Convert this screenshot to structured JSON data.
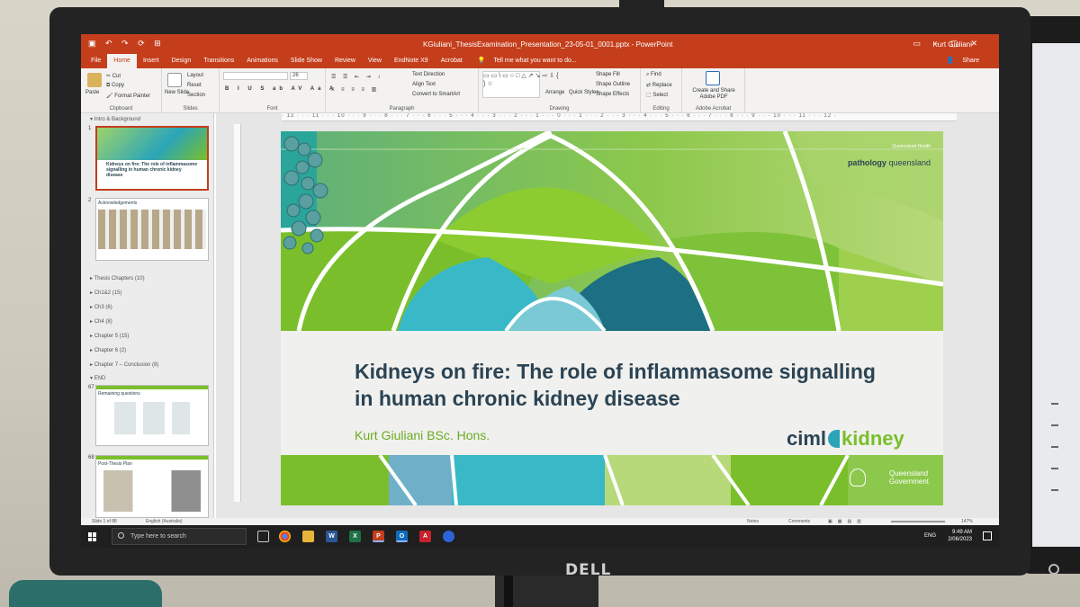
{
  "window": {
    "title": "KGiuliani_ThesisExamination_Presentation_23-05-01_0001.pptx - PowerPoint",
    "user": "Kurt Giuliani",
    "share": "Share"
  },
  "tabs": [
    "File",
    "Home",
    "Insert",
    "Design",
    "Transitions",
    "Animations",
    "Slide Show",
    "Review",
    "View",
    "EndNote X9",
    "Acrobat"
  ],
  "tell_me": "Tell me what you want to do...",
  "ribbon": {
    "clipboard": {
      "paste": "Paste",
      "cut": "Cut",
      "copy": "Copy",
      "format_painter": "Format Painter",
      "label": "Clipboard"
    },
    "slides": {
      "new_slide": "New Slide",
      "layout": "Layout",
      "reset": "Reset",
      "section": "Section",
      "label": "Slides"
    },
    "font": {
      "label": "Font",
      "size": "26"
    },
    "paragraph": {
      "text_direction": "Text Direction",
      "align_text": "Align Text",
      "smartart": "Convert to SmartArt",
      "label": "Paragraph"
    },
    "drawing": {
      "arrange": "Arrange",
      "quick_styles": "Quick Styles",
      "shape_fill": "Shape Fill",
      "shape_outline": "Shape Outline",
      "shape_effects": "Shape Effects",
      "label": "Drawing"
    },
    "editing": {
      "find": "Find",
      "replace": "Replace",
      "select": "Select",
      "label": "Editing"
    },
    "acrobat": {
      "create": "Create and Share Adobe PDF",
      "label": "Adobe Acrobat"
    }
  },
  "sections": [
    "Intro & Background",
    "Thesis Chapters (10)",
    "Ch1&2 (15)",
    "Ch3 (6)",
    "Ch4 (8)",
    "Chapter 5 (15)",
    "Chapter 6 (2)",
    "Chapter 7 – Conclusion (8)",
    "END"
  ],
  "thumbnails": [
    {
      "num": "1",
      "text": "Kidneys on fire: The role of inflammasome signalling in human chronic kidney disease"
    },
    {
      "num": "2",
      "text": "Acknowledgements"
    },
    {
      "num": "67",
      "text": "Remaining questions"
    },
    {
      "num": "68",
      "text": "Post-Thesis Plan"
    }
  ],
  "ruler": "· 12 · · · 11 · · · 10 · · · 9 · · · 8 · · · 7 · · · 6 · · · 5 · · · 4 · · · 3 · · · 2 · · · 1 · · · 0 · · · 1 · · · 2 · · · 3 · · · 4 · · · 5 · · · 6 · · · 7 · · · 8 · · · 9 · · · 10 · · · 11 · · · 12 ·",
  "slide": {
    "org_small": "Queensland Health",
    "org_pathology": "pathology",
    "org_queensland": "queensland",
    "title": "Kidneys on fire: The role of inflammasome signalling in human chronic kidney disease",
    "author": "Kurt Giuliani BSc. Hons.",
    "brand_ciml": "ciml",
    "brand_kidney": "kidney",
    "gov_line1": "Queensland",
    "gov_line2": "Government"
  },
  "status": {
    "slide": "Slide 1 of 88",
    "language": "English (Australia)",
    "notes": "Notes",
    "comments": "Comments",
    "zoom": "147%"
  },
  "taskbar": {
    "search_placeholder": "Type here to search",
    "time": "9:49 AM",
    "date": "2/06/2023",
    "lang": "ENG"
  },
  "monitor_brand": "DELL"
}
